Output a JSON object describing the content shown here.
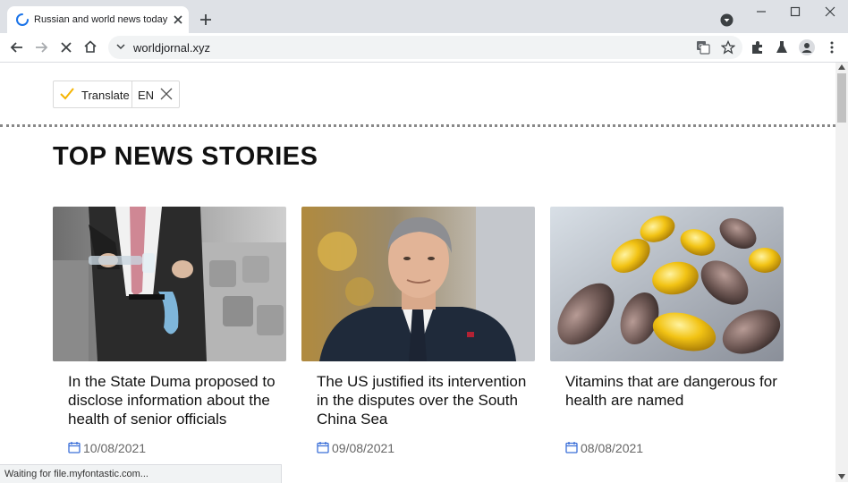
{
  "browser": {
    "tab_title": "Russian and world news today",
    "url": "worldjornal.xyz",
    "status": "Waiting for file.myfontastic.com..."
  },
  "translate_bar": {
    "label": "Translate",
    "language": "EN"
  },
  "page": {
    "heading": "TOP NEWS STORIES",
    "articles": [
      {
        "title": "In the State Duma proposed to disclose information about the health of senior officials",
        "date": "10/08/2021"
      },
      {
        "title": "The US justified its intervention in the disputes over the South China Sea",
        "date": "09/08/2021"
      },
      {
        "title": "Vitamins that are dangerous for health are named",
        "date": "08/08/2021"
      }
    ]
  },
  "colors": {
    "accent": "#1a73e8",
    "translate_check": "#f5b400",
    "date_icon": "#3b6fd8"
  }
}
